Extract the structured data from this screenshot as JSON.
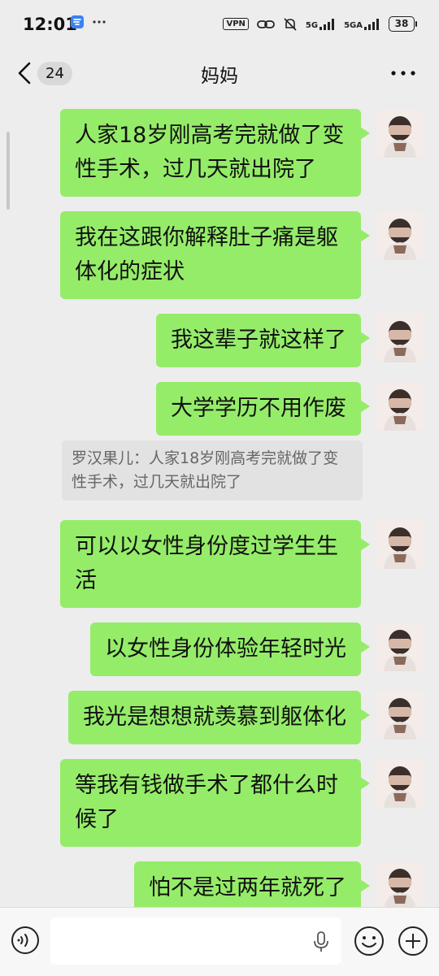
{
  "status_bar": {
    "time": "12:01",
    "vpn": "VPN",
    "signal_1": "5G",
    "signal_2": "5GA",
    "battery": "38"
  },
  "header": {
    "back_count": "24",
    "title": "妈妈"
  },
  "messages": [
    {
      "text": "人家18岁刚高考完就做了变性手术，过几天就出院了"
    },
    {
      "text": "我在这跟你解释肚子痛是躯体化的症状"
    },
    {
      "text": "我这辈子就这样了"
    },
    {
      "text": "大学学历不用作废"
    },
    {
      "text": "可以以女性身份度过学生生活"
    },
    {
      "text": "以女性身份体验年轻时光"
    },
    {
      "text": "我光是想想就羡慕到躯体化"
    },
    {
      "text": "等我有钱做手术了都什么时候了"
    },
    {
      "text": "怕不是过两年就死了"
    }
  ],
  "quote": {
    "text": "罗汉果儿：人家18岁刚高考完就做了变性手术，过几天就出院了"
  },
  "colors": {
    "bubble": "#95ec69",
    "background": "#ededed"
  }
}
